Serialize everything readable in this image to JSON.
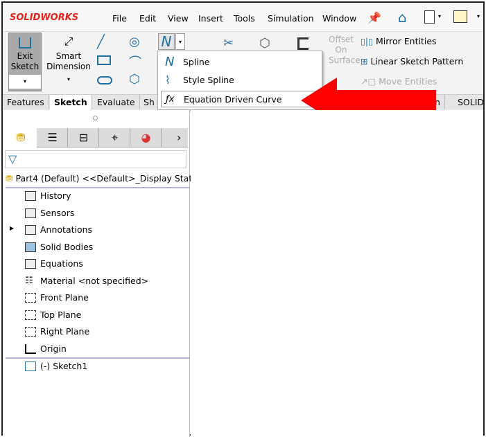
{
  "app": {
    "brand": "SOLIDWORKS"
  },
  "menu": [
    "File",
    "Edit",
    "View",
    "Insert",
    "Tools",
    "Simulation",
    "Window"
  ],
  "ribbon": {
    "exit_sketch": "Exit\nSketch",
    "smart_dimension": "Smart\nDimension",
    "offset_on_surface": "Offset\nOn\nSurface",
    "mirror": "Mirror Entities",
    "linear_pattern": "Linear Sketch Pattern",
    "move": "Move Entities"
  },
  "spline_menu": [
    "Spline",
    "Style Spline",
    "Equation Driven Curve"
  ],
  "tabs": [
    "Features",
    "Sketch",
    "Evaluate",
    "Sh",
    "tion",
    "SOLID"
  ],
  "tree": {
    "root": "Part4 (Default) <<Default>_Display State",
    "items": [
      "History",
      "Sensors",
      "Annotations",
      "Solid Bodies",
      "Equations",
      "Material <not specified>",
      "Front Plane",
      "Top Plane",
      "Right Plane",
      "Origin"
    ],
    "sketch": "(-) Sketch1"
  },
  "colors": {
    "arrow": "#ff0000",
    "accent": "#1f6fa0"
  }
}
